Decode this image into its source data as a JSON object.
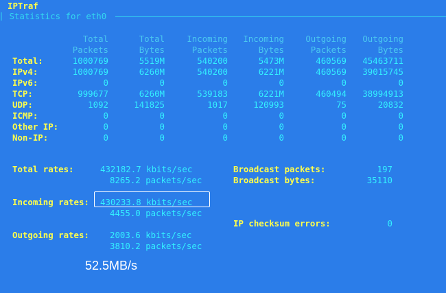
{
  "app": {
    "title": "IPTraf",
    "window_title": " Statistics for eth0 "
  },
  "columns": [
    {
      "top": "Total",
      "bottom": "Packets"
    },
    {
      "top": "Total",
      "bottom": "Bytes"
    },
    {
      "top": "Incoming",
      "bottom": "Packets"
    },
    {
      "top": "Incoming",
      "bottom": "Bytes"
    },
    {
      "top": "Outgoing",
      "bottom": "Packets"
    },
    {
      "top": "Outgoing",
      "bottom": "Bytes"
    }
  ],
  "rows": [
    {
      "label": "Total:",
      "values": [
        "1000769",
        "5519M",
        "540200",
        "5473M",
        "460569",
        "45463711"
      ]
    },
    {
      "label": "IPv4:",
      "values": [
        "1000769",
        "6260M",
        "540200",
        "6221M",
        "460569",
        "39015745"
      ]
    },
    {
      "label": "IPv6:",
      "values": [
        "0",
        "0",
        "0",
        "0",
        "0",
        "0"
      ]
    },
    {
      "label": "TCP:",
      "values": [
        "999677",
        "6260M",
        "539183",
        "6221M",
        "460494",
        "38994913"
      ]
    },
    {
      "label": "UDP:",
      "values": [
        "1092",
        "141825",
        "1017",
        "120993",
        "75",
        "20832"
      ]
    },
    {
      "label": "ICMP:",
      "values": [
        "0",
        "0",
        "0",
        "0",
        "0",
        "0"
      ]
    },
    {
      "label": "Other IP:",
      "values": [
        "0",
        "0",
        "0",
        "0",
        "0",
        "0"
      ]
    },
    {
      "label": "Non-IP:",
      "values": [
        "0",
        "0",
        "0",
        "0",
        "0",
        "0"
      ]
    }
  ],
  "rates": {
    "total": {
      "label": "Total rates:",
      "kbits": "432182.7 kbits/sec",
      "packets": "8265.2 packets/sec"
    },
    "incoming": {
      "label": "Incoming rates:",
      "kbits": "430233.8 kbits/sec",
      "packets": "4455.0 packets/sec"
    },
    "outgoing": {
      "label": "Outgoing rates:",
      "kbits": "2003.6 kbits/sec",
      "packets": "3810.2 packets/sec"
    }
  },
  "broadcast": {
    "packets_label": "Broadcast packets:",
    "packets_value": "197",
    "bytes_label": "Broadcast bytes:",
    "bytes_value": "35110"
  },
  "checksum": {
    "label": "IP checksum errors:",
    "value": "0"
  },
  "annotation": {
    "speed": "52.5MB/s"
  },
  "colors": {
    "background": "#2b7de9",
    "label_yellow": "#ffff4c",
    "value_cyan": "#33f0ff"
  }
}
